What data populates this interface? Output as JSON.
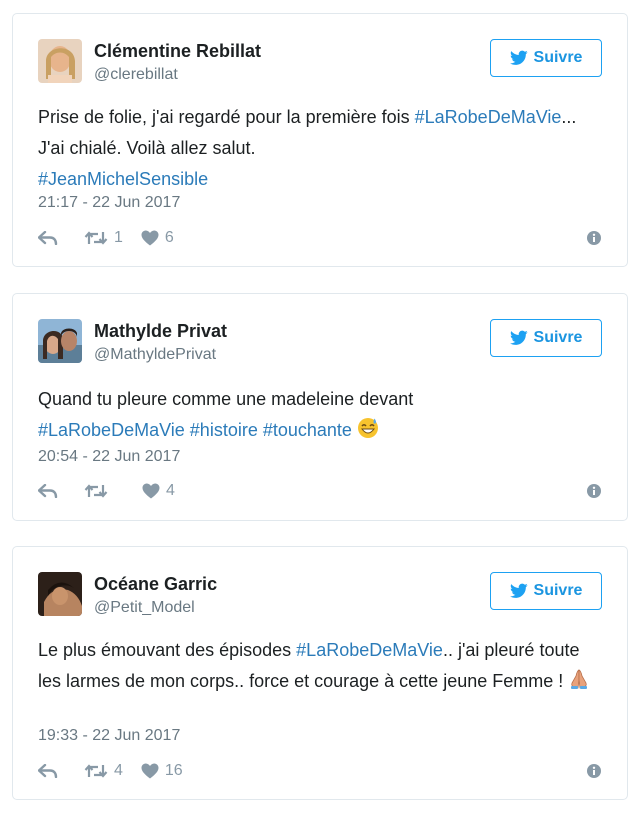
{
  "colors": {
    "accent": "#1da1f2",
    "hashtag": "#2b7bb9",
    "muted": "#697882",
    "icon": "#8899a6",
    "border": "#e1e8ed"
  },
  "tweets": [
    {
      "name": "Clémentine Rebillat",
      "handle": "@clerebillat",
      "follow_label": "Suivre",
      "text_segments": [
        "Prise de folie, j'ai regardé pour la première fois ",
        "#LaRobeDeMaVie",
        "... J'ai chialé. Voilà allez salut. ",
        "#JeanMichelSensible"
      ],
      "timestamp": "21:17 - 22 Jun 2017",
      "retweets": "1",
      "likes": "6"
    },
    {
      "name": "Mathylde Privat",
      "handle": "@MathyldePrivat",
      "follow_label": "Suivre",
      "text_segments": [
        "Quand tu pleure comme une madeleine devant ",
        "#LaRobeDeMaVie",
        "#histoire",
        "#touchante"
      ],
      "emoji": "grinning-sweat-face-emoji",
      "timestamp": "20:54 - 22 Jun 2017",
      "retweets": "",
      "likes": "4"
    },
    {
      "name": "Océane Garric",
      "handle": "@Petit_Model",
      "follow_label": "Suivre",
      "text_segments": [
        "Le plus émouvant des épisodes ",
        "#LaRobeDeMaVie",
        ".. j'ai pleuré toute les larmes de mon corps.. force et courage à cette jeune Femme ! "
      ],
      "emoji": "folded-hands-emoji",
      "timestamp": "19:33 - 22 Jun 2017",
      "retweets": "4",
      "likes": "16"
    }
  ]
}
